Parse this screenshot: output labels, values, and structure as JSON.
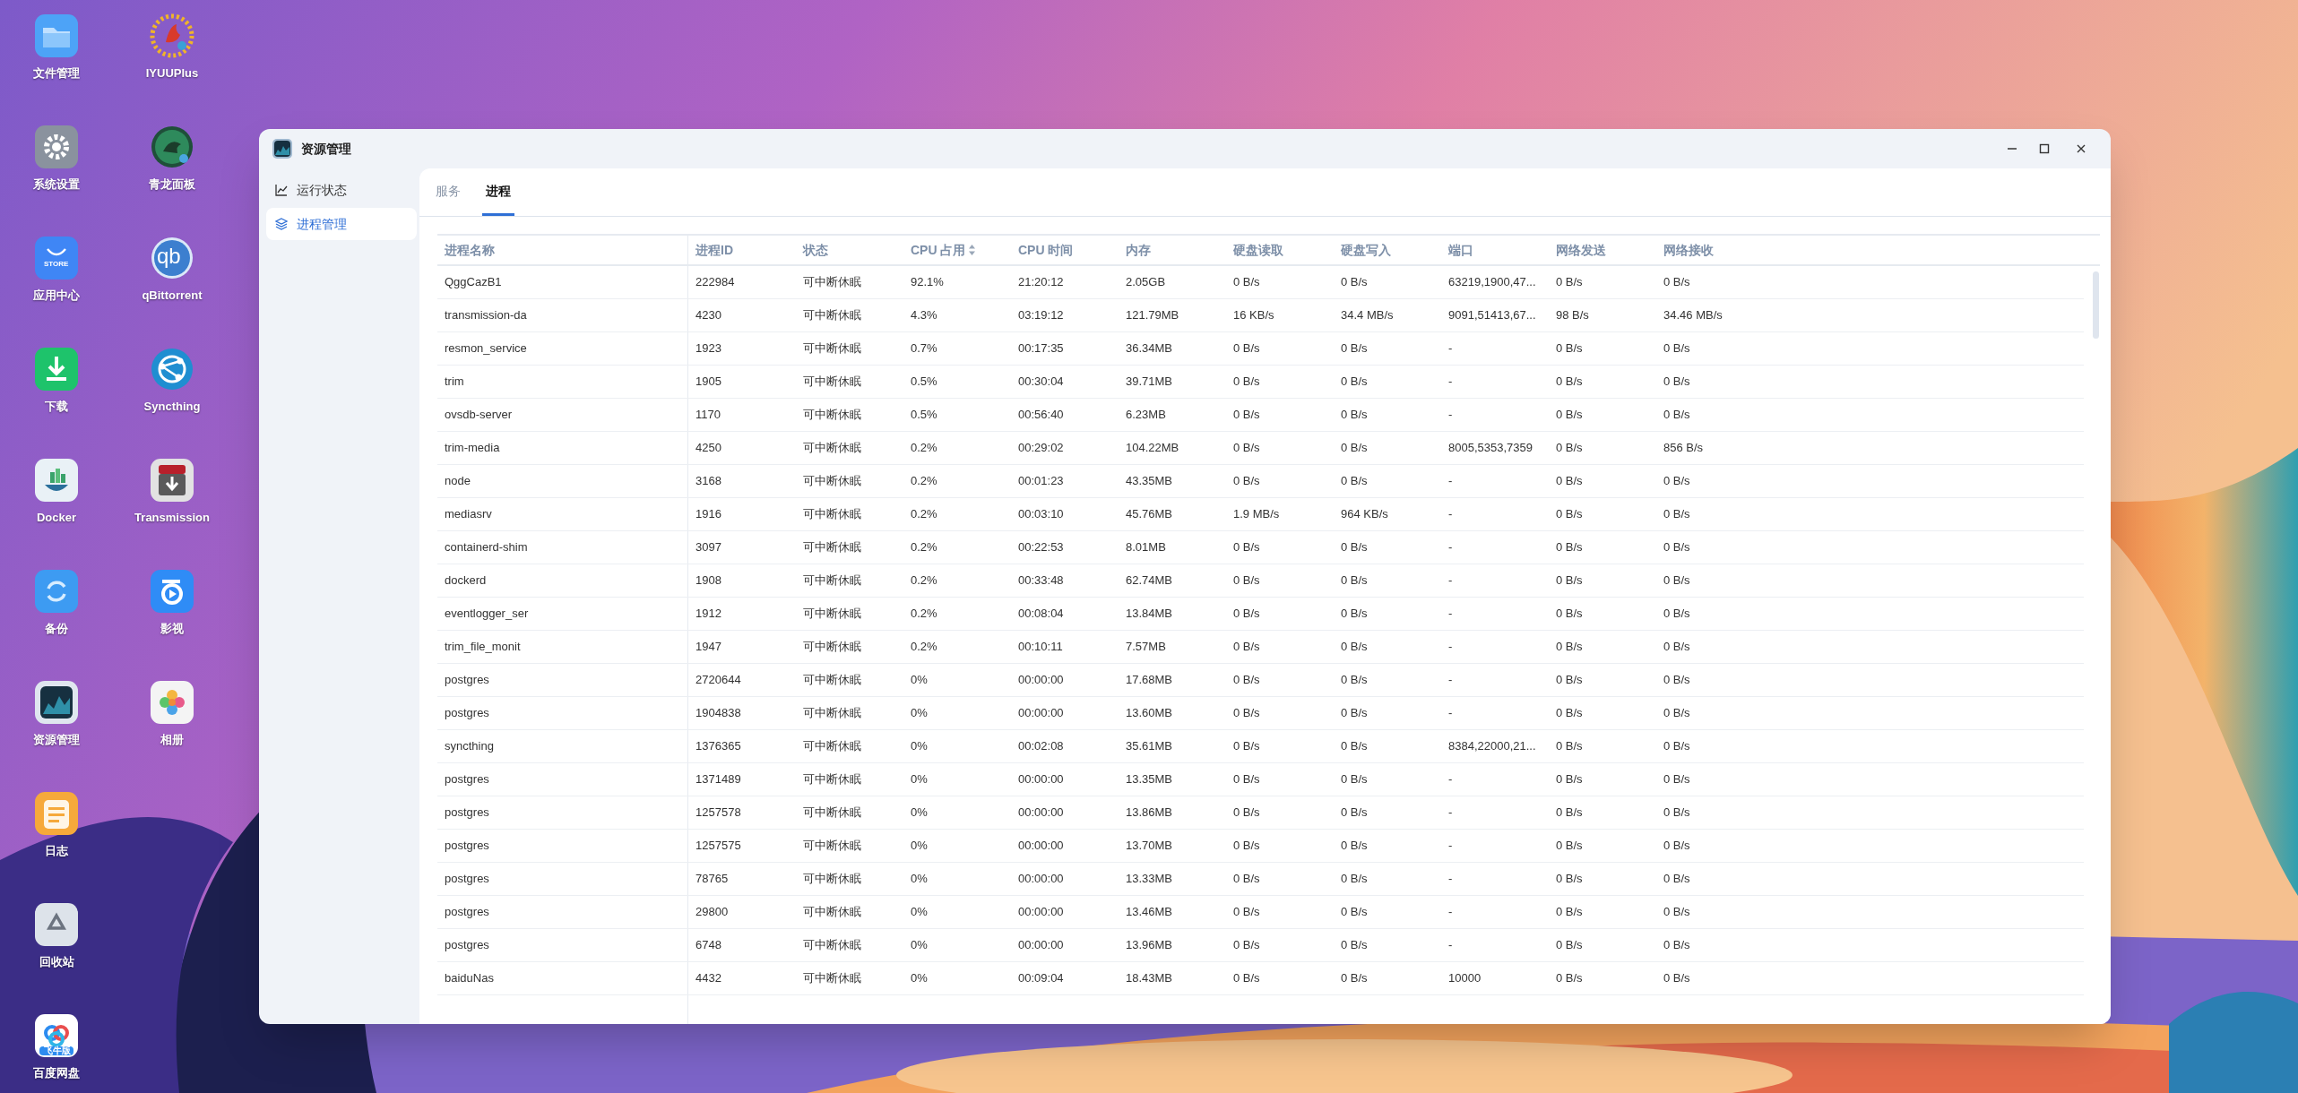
{
  "desktop_icons": [
    {
      "label": "文件管理"
    },
    {
      "label": "系统设置"
    },
    {
      "label": "应用中心",
      "glyph": "STORE"
    },
    {
      "label": "下载"
    },
    {
      "label": "Docker"
    },
    {
      "label": "备份"
    },
    {
      "label": "资源管理"
    },
    {
      "label": "日志"
    },
    {
      "label": "回收站"
    },
    {
      "label": "百度网盘",
      "glyph": "飞牛版"
    },
    {
      "label": "IYUUPlus"
    },
    {
      "label": "青龙面板"
    },
    {
      "label": "qBittorrent",
      "glyph": "qb"
    },
    {
      "label": "Syncthing"
    },
    {
      "label": "Transmission"
    },
    {
      "label": "影视"
    },
    {
      "label": "相册"
    }
  ],
  "window": {
    "title": "资源管理"
  },
  "sidebar": {
    "items": [
      {
        "label": "运行状态",
        "selected": false
      },
      {
        "label": "进程管理",
        "selected": true
      }
    ]
  },
  "tabs": [
    {
      "label": "服务",
      "selected": false
    },
    {
      "label": "进程",
      "selected": true
    }
  ],
  "table": {
    "columns": [
      {
        "label": "进程名称",
        "sortable": false
      },
      {
        "label": "进程ID",
        "sortable": false
      },
      {
        "label": "状态",
        "sortable": false
      },
      {
        "label": "CPU 占用",
        "sortable": true
      },
      {
        "label": "CPU 时间",
        "sortable": false
      },
      {
        "label": "内存",
        "sortable": false
      },
      {
        "label": "硬盘读取",
        "sortable": false
      },
      {
        "label": "硬盘写入",
        "sortable": false
      },
      {
        "label": "端口",
        "sortable": false
      },
      {
        "label": "网络发送",
        "sortable": false
      },
      {
        "label": "网络接收",
        "sortable": false
      }
    ],
    "rows": [
      [
        "QggCazB1",
        "222984",
        "可中断休眠",
        "92.1%",
        "21:20:12",
        "2.05GB",
        "0 B/s",
        "0 B/s",
        "63219,1900,47...",
        "0 B/s",
        "0 B/s"
      ],
      [
        "transmission-da",
        "4230",
        "可中断休眠",
        "4.3%",
        "03:19:12",
        "121.79MB",
        "16 KB/s",
        "34.4 MB/s",
        "9091,51413,67...",
        "98 B/s",
        "34.46 MB/s"
      ],
      [
        "resmon_service",
        "1923",
        "可中断休眠",
        "0.7%",
        "00:17:35",
        "36.34MB",
        "0 B/s",
        "0 B/s",
        "-",
        "0 B/s",
        "0 B/s"
      ],
      [
        "trim",
        "1905",
        "可中断休眠",
        "0.5%",
        "00:30:04",
        "39.71MB",
        "0 B/s",
        "0 B/s",
        "-",
        "0 B/s",
        "0 B/s"
      ],
      [
        "ovsdb-server",
        "1170",
        "可中断休眠",
        "0.5%",
        "00:56:40",
        "6.23MB",
        "0 B/s",
        "0 B/s",
        "-",
        "0 B/s",
        "0 B/s"
      ],
      [
        "trim-media",
        "4250",
        "可中断休眠",
        "0.2%",
        "00:29:02",
        "104.22MB",
        "0 B/s",
        "0 B/s",
        "8005,5353,7359",
        "0 B/s",
        "856 B/s"
      ],
      [
        "node",
        "3168",
        "可中断休眠",
        "0.2%",
        "00:01:23",
        "43.35MB",
        "0 B/s",
        "0 B/s",
        "-",
        "0 B/s",
        "0 B/s"
      ],
      [
        "mediasrv",
        "1916",
        "可中断休眠",
        "0.2%",
        "00:03:10",
        "45.76MB",
        "1.9 MB/s",
        "964 KB/s",
        "-",
        "0 B/s",
        "0 B/s"
      ],
      [
        "containerd-shim",
        "3097",
        "可中断休眠",
        "0.2%",
        "00:22:53",
        "8.01MB",
        "0 B/s",
        "0 B/s",
        "-",
        "0 B/s",
        "0 B/s"
      ],
      [
        "dockerd",
        "1908",
        "可中断休眠",
        "0.2%",
        "00:33:48",
        "62.74MB",
        "0 B/s",
        "0 B/s",
        "-",
        "0 B/s",
        "0 B/s"
      ],
      [
        "eventlogger_ser",
        "1912",
        "可中断休眠",
        "0.2%",
        "00:08:04",
        "13.84MB",
        "0 B/s",
        "0 B/s",
        "-",
        "0 B/s",
        "0 B/s"
      ],
      [
        "trim_file_monit",
        "1947",
        "可中断休眠",
        "0.2%",
        "00:10:11",
        "7.57MB",
        "0 B/s",
        "0 B/s",
        "-",
        "0 B/s",
        "0 B/s"
      ],
      [
        "postgres",
        "2720644",
        "可中断休眠",
        "0%",
        "00:00:00",
        "17.68MB",
        "0 B/s",
        "0 B/s",
        "-",
        "0 B/s",
        "0 B/s"
      ],
      [
        "postgres",
        "1904838",
        "可中断休眠",
        "0%",
        "00:00:00",
        "13.60MB",
        "0 B/s",
        "0 B/s",
        "-",
        "0 B/s",
        "0 B/s"
      ],
      [
        "syncthing",
        "1376365",
        "可中断休眠",
        "0%",
        "00:02:08",
        "35.61MB",
        "0 B/s",
        "0 B/s",
        "8384,22000,21...",
        "0 B/s",
        "0 B/s"
      ],
      [
        "postgres",
        "1371489",
        "可中断休眠",
        "0%",
        "00:00:00",
        "13.35MB",
        "0 B/s",
        "0 B/s",
        "-",
        "0 B/s",
        "0 B/s"
      ],
      [
        "postgres",
        "1257578",
        "可中断休眠",
        "0%",
        "00:00:00",
        "13.86MB",
        "0 B/s",
        "0 B/s",
        "-",
        "0 B/s",
        "0 B/s"
      ],
      [
        "postgres",
        "1257575",
        "可中断休眠",
        "0%",
        "00:00:00",
        "13.70MB",
        "0 B/s",
        "0 B/s",
        "-",
        "0 B/s",
        "0 B/s"
      ],
      [
        "postgres",
        "78765",
        "可中断休眠",
        "0%",
        "00:00:00",
        "13.33MB",
        "0 B/s",
        "0 B/s",
        "-",
        "0 B/s",
        "0 B/s"
      ],
      [
        "postgres",
        "29800",
        "可中断休眠",
        "0%",
        "00:00:00",
        "13.46MB",
        "0 B/s",
        "0 B/s",
        "-",
        "0 B/s",
        "0 B/s"
      ],
      [
        "postgres",
        "6748",
        "可中断休眠",
        "0%",
        "00:00:00",
        "13.96MB",
        "0 B/s",
        "0 B/s",
        "-",
        "0 B/s",
        "0 B/s"
      ],
      [
        "baiduNas",
        "4432",
        "可中断休眠",
        "0%",
        "00:09:04",
        "18.43MB",
        "0 B/s",
        "0 B/s",
        "10000",
        "0 B/s",
        "0 B/s"
      ]
    ]
  }
}
